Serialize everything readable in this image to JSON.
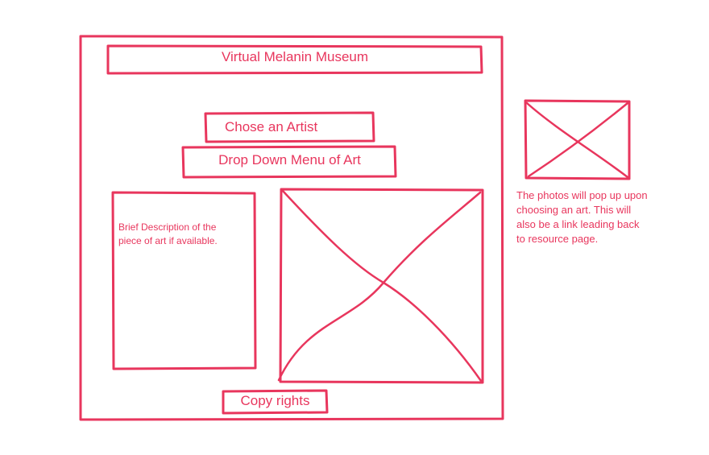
{
  "wireframe": {
    "title_label": "Virtual Melanin Museum",
    "artist_label": "Chose an Artist",
    "dropdown_label": "Drop Down Menu of Art",
    "description_lines": [
      "Brief Description of the",
      "piece of art if available."
    ],
    "footer_label": "Copy rights"
  },
  "annotation": {
    "lines": [
      "The photos will pop up upon",
      "choosing an art. This will",
      "also be a link leading back",
      "to resource page."
    ]
  },
  "colors": {
    "stroke": "#e8365d",
    "text": "#e8365d",
    "background": "#ffffff"
  }
}
